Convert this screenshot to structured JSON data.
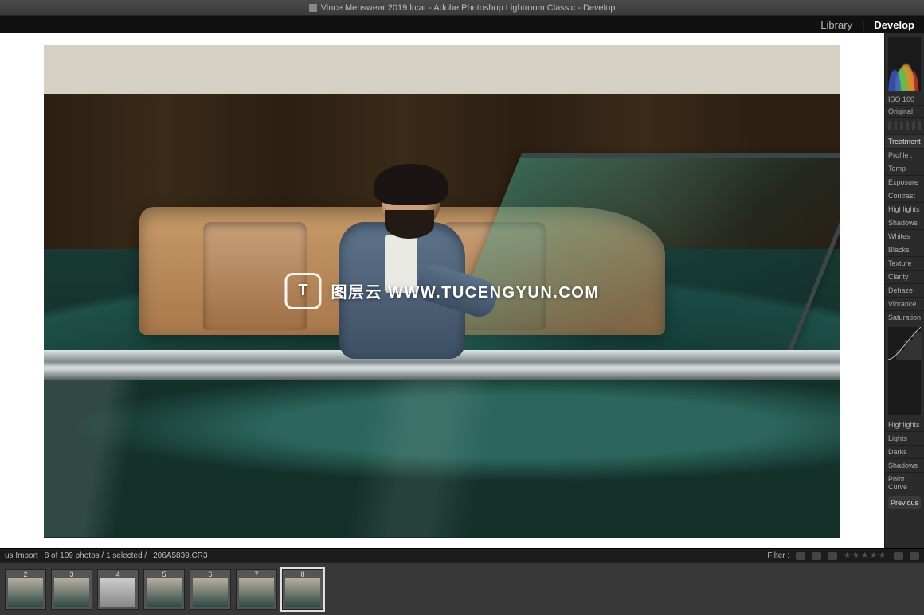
{
  "titlebar": {
    "title": "Vince Menswear 2019.lrcat - Adobe Photoshop Lightroom Classic - Develop"
  },
  "modules": {
    "library": "Library",
    "develop": "Develop",
    "separator": "|"
  },
  "watermark": {
    "badge_letter": "T",
    "text": "图层云 WWW.TUCENGYUN.COM"
  },
  "right_panel": {
    "iso_label": "ISO 100",
    "original_label": "Original",
    "treatment_label": "Treatment",
    "profile_label": "Profile :",
    "basic_labels": {
      "temp": "Temp",
      "exposure": "Exposure",
      "contrast": "Contrast",
      "highlights": "Highlights",
      "shadows": "Shadows",
      "whites": "Whites",
      "blacks": "Blacks",
      "texture": "Texture",
      "clarity": "Clarity",
      "dehaze": "Dehaze",
      "vibrance": "Vibrance",
      "saturation": "Saturation"
    },
    "tone_labels": {
      "highlights": "Highlights",
      "lights": "Lights",
      "darks": "Darks",
      "shadows": "Shadows"
    },
    "point_curve_label": "Point Curve",
    "previous_button": "Previous"
  },
  "status": {
    "left_source": "us Import",
    "count_text": "8 of 109 photos / 1 selected /",
    "filename": "206A5839.CR3",
    "filter_label": "Filter :"
  },
  "filmstrip": {
    "thumbs": [
      {
        "index": "2"
      },
      {
        "index": "3"
      },
      {
        "index": "4"
      },
      {
        "index": "5"
      },
      {
        "index": "6"
      },
      {
        "index": "7"
      },
      {
        "index": "8"
      }
    ],
    "selected_index": "8"
  }
}
